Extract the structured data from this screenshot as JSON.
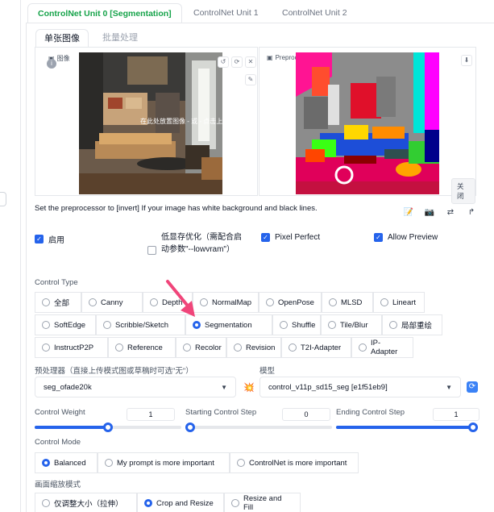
{
  "unit_tabs": [
    "ControlNet Unit 0 [Segmentation]",
    "ControlNet Unit 1",
    "ControlNet Unit 2"
  ],
  "image_tabs": [
    "单张图像",
    "批量处理"
  ],
  "input_image": {
    "label": "图像",
    "overlay_text": "在此处放置图像 - 或 - 点击上传"
  },
  "preview": {
    "label": "Preprocessor Preview",
    "close_label": "关闭"
  },
  "hint": "Set the preprocessor to [invert] If your image has white background and black lines.",
  "options": {
    "enable": "启用",
    "lowvram": "低显存优化（需配合启动参数\"--lowvram\"）",
    "pixel_perfect": "Pixel Perfect",
    "allow_preview": "Allow Preview"
  },
  "control_type": {
    "label": "Control Type",
    "rows": [
      [
        "全部",
        "Canny",
        "Depth",
        "NormalMap",
        "OpenPose",
        "MLSD",
        "Lineart"
      ],
      [
        "SoftEdge",
        "Scribble/Sketch",
        "Segmentation",
        "Shuffle",
        "Tile/Blur",
        "局部重绘"
      ],
      [
        "InstructP2P",
        "Reference",
        "Recolor",
        "Revision",
        "T2I-Adapter",
        "IP-Adapter"
      ]
    ],
    "selected": "Segmentation"
  },
  "preprocessor": {
    "label": "预处理器（直接上传模式图或草稿时可选\"无\"）",
    "value": "seg_ofade20k"
  },
  "model": {
    "label": "模型",
    "value": "control_v11p_sd15_seg [e1f51eb9]"
  },
  "sliders": [
    {
      "label": "Control Weight",
      "value": "1",
      "fraction": 0.5
    },
    {
      "label": "Starting Control Step",
      "value": "0",
      "fraction": 0.0
    },
    {
      "label": "Ending Control Step",
      "value": "1",
      "fraction": 1.0
    }
  ],
  "control_mode": {
    "label": "Control Mode",
    "options": [
      "Balanced",
      "My prompt is more important",
      "ControlNet is more important"
    ],
    "selected": "Balanced"
  },
  "resize_mode": {
    "label": "画面缩放模式",
    "options": [
      "仅调整大小（拉伸）",
      "Crop and Resize",
      "Resize and Fill"
    ],
    "selected": "Crop and Resize"
  },
  "colors": {
    "accent": "#2563eb",
    "active_tab": "#16a34a",
    "arrow": "#f0457a"
  }
}
